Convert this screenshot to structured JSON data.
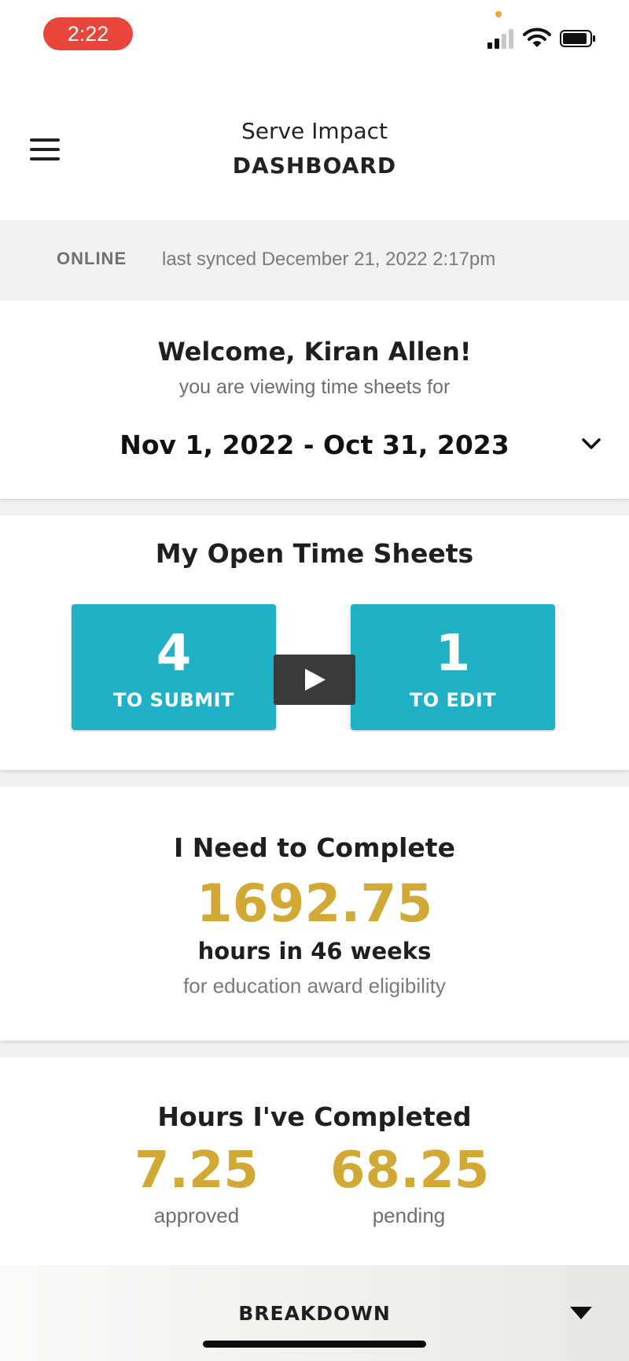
{
  "status_bar": {
    "time": "2:22",
    "icons": [
      "signal-icon",
      "wifi-icon",
      "battery-icon"
    ]
  },
  "header": {
    "app_name": "Serve Impact",
    "page_title": "DASHBOARD",
    "menu_icon": "hamburger-menu-icon"
  },
  "sync": {
    "status": "ONLINE",
    "last_synced": "last synced December 21, 2022 2:17pm"
  },
  "welcome": {
    "greeting": "Welcome, Kiran Allen!",
    "subtitle": "you are viewing time sheets for",
    "date_range": "Nov 1, 2022 - Oct 31, 2023"
  },
  "open_time_sheets": {
    "title": "My Open Time Sheets",
    "to_submit_count": "4",
    "to_submit_label": "TO SUBMIT",
    "to_edit_count": "1",
    "to_edit_label": "TO EDIT"
  },
  "need_to_complete": {
    "title": "I Need to Complete",
    "hours": "1692.75",
    "hours_text": "hours in 46 weeks",
    "note": "for education award eligibility"
  },
  "hours_completed": {
    "title": "Hours I've Completed",
    "approved_value": "7.25",
    "approved_label": "approved",
    "pending_value": "68.25",
    "pending_label": "pending"
  },
  "breakdown": {
    "label": "BREAKDOWN"
  },
  "colors": {
    "accent_teal": "#21b1c6",
    "gold": "#d2a935",
    "time_pill": "#e8463b"
  }
}
